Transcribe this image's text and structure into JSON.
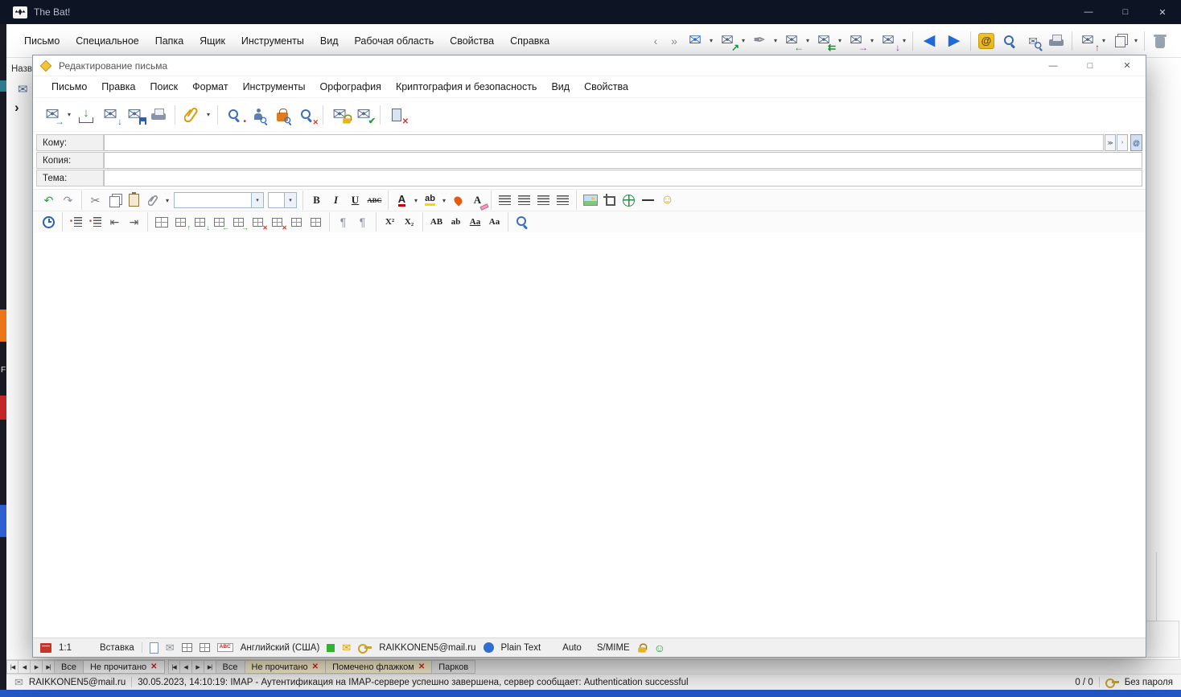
{
  "icons": {
    "envelope": "✉",
    "dropdown": "▾",
    "overflow_left": "‹",
    "overflow_right": "»",
    "expand_chevron": "›",
    "arrow_left": "←",
    "arrow_right": "→",
    "arrow_up": "↑",
    "arrow_down": "↓",
    "arrow_up_right": "↗",
    "double_arrow_left": "⇇",
    "pen": "✒",
    "at_sign": "@",
    "nav_first": "|◀",
    "nav_prev": "◀",
    "nav_next": "▶",
    "nav_last": "▶|",
    "undo": "↶",
    "redo": "↷",
    "scissors": "✂",
    "check": "✔",
    "cross": "✕",
    "smiley": "☺",
    "minimize": "—",
    "maximize": "□",
    "close": "✕",
    "bold": "B",
    "italic": "I",
    "underline": "U",
    "strikethrough": "ABC",
    "letter_a": "A",
    "highlight_ab": "ab",
    "superscript": "X²",
    "subscript": "X₂",
    "uppercase": "AB",
    "lowercase": "ab",
    "capitalize": "Aa",
    "pilcrow": "¶",
    "bullet": "•",
    "abc_spell": "ABC",
    "outdent": "⇤",
    "indent": "⇥",
    "chevron_dbl_down": "≫"
  },
  "desktop": {
    "icon_label": "F"
  },
  "main_window": {
    "title": "The Bat!",
    "menu": {
      "items": [
        "Письмо",
        "Специальное",
        "Папка",
        "Ящик",
        "Инструменты",
        "Вид",
        "Рабочая область",
        "Свойства",
        "Справка"
      ]
    },
    "folder_pane": {
      "column_header": "Назва"
    },
    "tab_bar_left": {
      "tabs": [
        "Все",
        "Не прочитано"
      ]
    },
    "tab_bar_right": {
      "tabs": [
        "Все",
        "Не прочитано",
        "Помечено флажком",
        "Парков"
      ]
    },
    "status_bar": {
      "account": "RAIKKONEN5@mail.ru",
      "message": "30.05.2023, 14:10:19: IMAP  - Аутентификация на IMAP-сервере успешно завершена, сервер сообщает: Authentication successful",
      "counter": "0 / 0",
      "password_label": "Без пароля"
    }
  },
  "compose_window": {
    "title": "Редактирование письма",
    "menu": {
      "items": [
        "Письмо",
        "Правка",
        "Поиск",
        "Формат",
        "Инструменты",
        "Орфография",
        "Криптография и безопасность",
        "Вид",
        "Свойства"
      ]
    },
    "fields": {
      "to_label": "Кому:",
      "cc_label": "Копия:",
      "subject_label": "Тема:",
      "to_value": "",
      "cc_value": "",
      "subject_value": ""
    },
    "status_bar": {
      "cursor_position": "1:1",
      "input_mode": "Вставка",
      "spell_language": "Английский (США)",
      "account": "RAIKKONEN5@mail.ru",
      "format": "Plain Text",
      "encoding": "Auto",
      "security": "S/MIME"
    }
  }
}
